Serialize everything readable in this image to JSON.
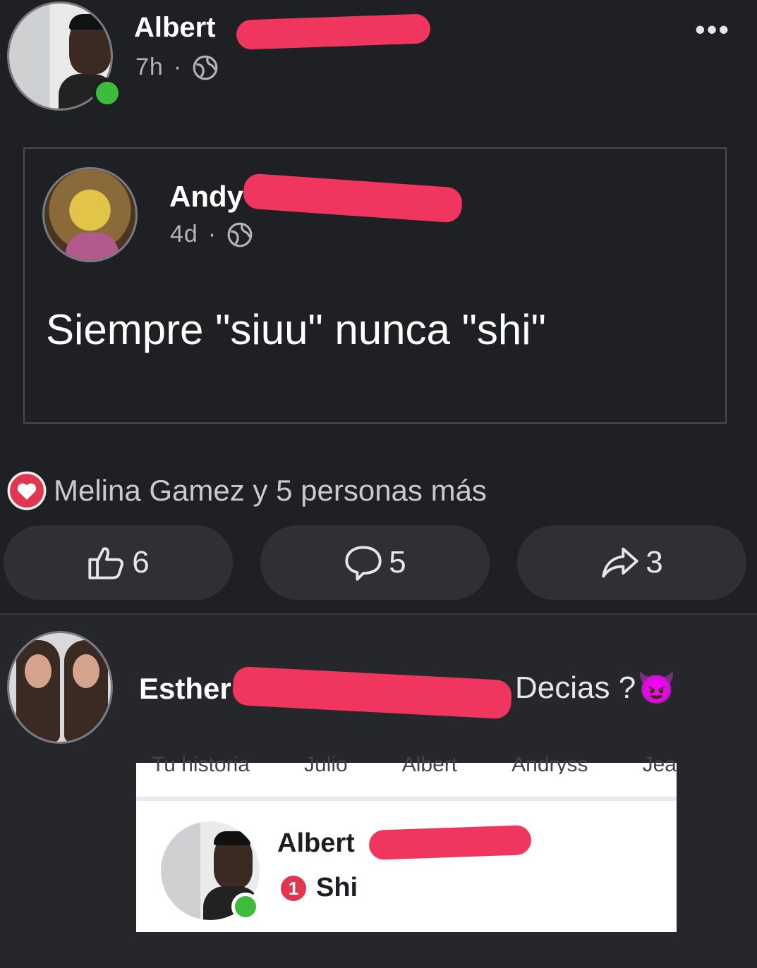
{
  "post": {
    "author": "Albert",
    "time": "7h",
    "more_label": "•••",
    "shared": {
      "author": "Andy B",
      "time": "4d",
      "text": "Siempre \"siuu\" nunca \"shi\""
    },
    "reactions_text": "Melina Gamez y 5 personas más",
    "likes": "6",
    "comments": "5",
    "shares": "3"
  },
  "comment": {
    "author": "Esther",
    "text": "Decias ?",
    "emoji": "😈",
    "screenshot": {
      "story_tabs": [
        "Tu historia",
        "Julio",
        "Albert",
        "Andryss",
        "Jea"
      ],
      "name": "Albert",
      "badge": "1",
      "message": "Shi"
    }
  },
  "colors": {
    "accent_online": "#3dbb3d",
    "heart": "#e0364f",
    "redaction": "#f0365e"
  }
}
